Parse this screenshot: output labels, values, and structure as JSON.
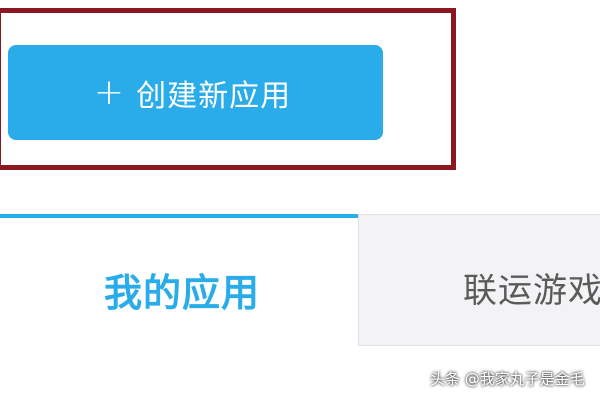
{
  "create_button": {
    "icon": "plus-icon",
    "plus_glyph": "+",
    "label": "创建新应用"
  },
  "tabs": [
    {
      "label": "我的应用",
      "active": true
    },
    {
      "label": "联运游戏",
      "active": false
    }
  ],
  "watermark": "头条 @我家丸子是金毛",
  "colors": {
    "accent": "#2aacea",
    "highlight_border": "#8b1722",
    "inactive_tab_bg": "#f3f3f5"
  }
}
